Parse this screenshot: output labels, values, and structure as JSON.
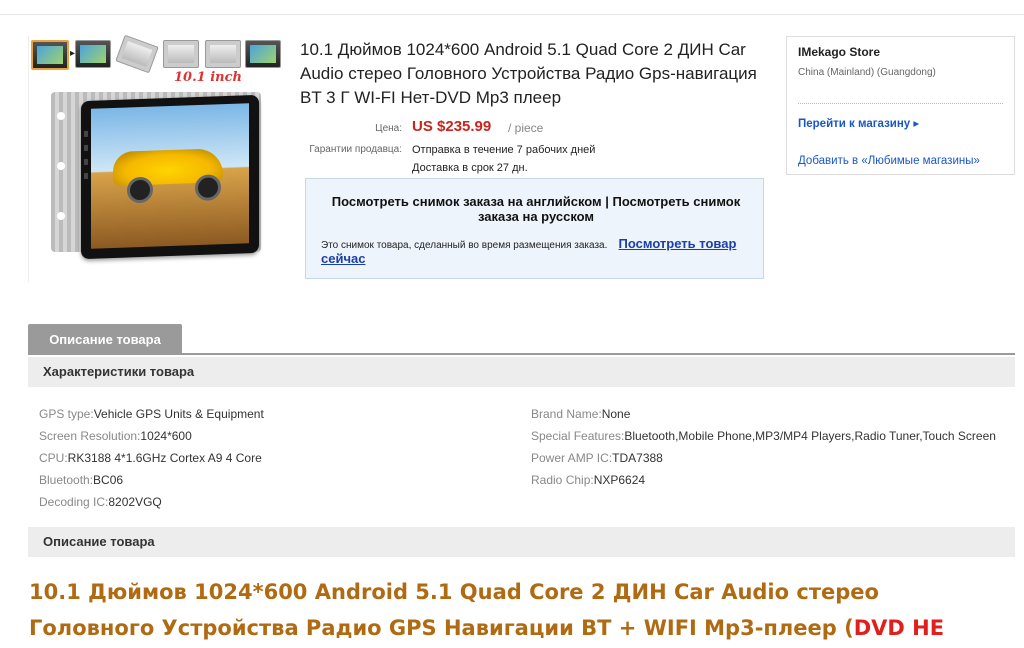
{
  "product": {
    "title": "10.1 Дюймов 1024*600 Android 5.1 Quad Core 2 ДИН Car Audio стерео Головного Устройства Радио Gps-навигация BT 3 Г WI-FI Нет-DVD Mp3 плеер",
    "price_label": "Цена:",
    "price": "US $235.99",
    "price_unit": "/ piece",
    "guarantee_label": "Гарантии продавца:",
    "dispatch": "Отправка в течение 7 рабочих дней",
    "delivery": "Доставка в срок 27 дн.",
    "image_brand_text": "10.1 inch"
  },
  "notice": {
    "heading": "Посмотреть снимок заказа на английском | Посмотреть снимок заказа на русском",
    "body": "Это снимок товара, сделанный во время размещения заказа.",
    "link": "Посмотреть товар сейчас"
  },
  "store": {
    "name": "IMekago Store",
    "location": "China (Mainland) (Guangdong)",
    "visit_link": "Перейти к магазину",
    "visit_arrow": "▸",
    "favorite_link": "Добавить в «Любимые магазины»"
  },
  "tabs": {
    "description": "Описание товара"
  },
  "specs_title": "Характеристики товара",
  "specs_left": [
    {
      "key": "GPS type:",
      "value": "Vehicle GPS Units & Equipment"
    },
    {
      "key": "Screen Resolution:",
      "value": "1024*600"
    },
    {
      "key": "CPU:",
      "value": "RK3188 4*1.6GHz Cortex A9 4 Core"
    },
    {
      "key": "Bluetooth:",
      "value": "BC06"
    },
    {
      "key": "Decoding IC:",
      "value": "8202VGQ"
    }
  ],
  "specs_right": [
    {
      "key": "Brand Name:",
      "value": "None"
    },
    {
      "key": "Special Features:",
      "value": "Bluetooth,Mobile Phone,MP3/MP4 Players,Radio Tuner,Touch Screen"
    },
    {
      "key": "Power AMP IC:",
      "value": "TDA7388"
    },
    {
      "key": "Radio Chip:",
      "value": "NXP6624"
    }
  ],
  "description_title": "Описание товара",
  "description": {
    "line1": "10.1 Дюймов 1024*600 Android 5.1 Quad Core 2 ДИН Car Audio стерео",
    "line2": "Головного Устройства Радио GPS Навигации BT + WIFI Mp3-плеер (",
    "line2_red": "DVD НЕ"
  },
  "colors": {
    "price": "#c7261d",
    "link": "#1b56c5",
    "description": "#b06a11",
    "tab": "#9a9a9a"
  }
}
